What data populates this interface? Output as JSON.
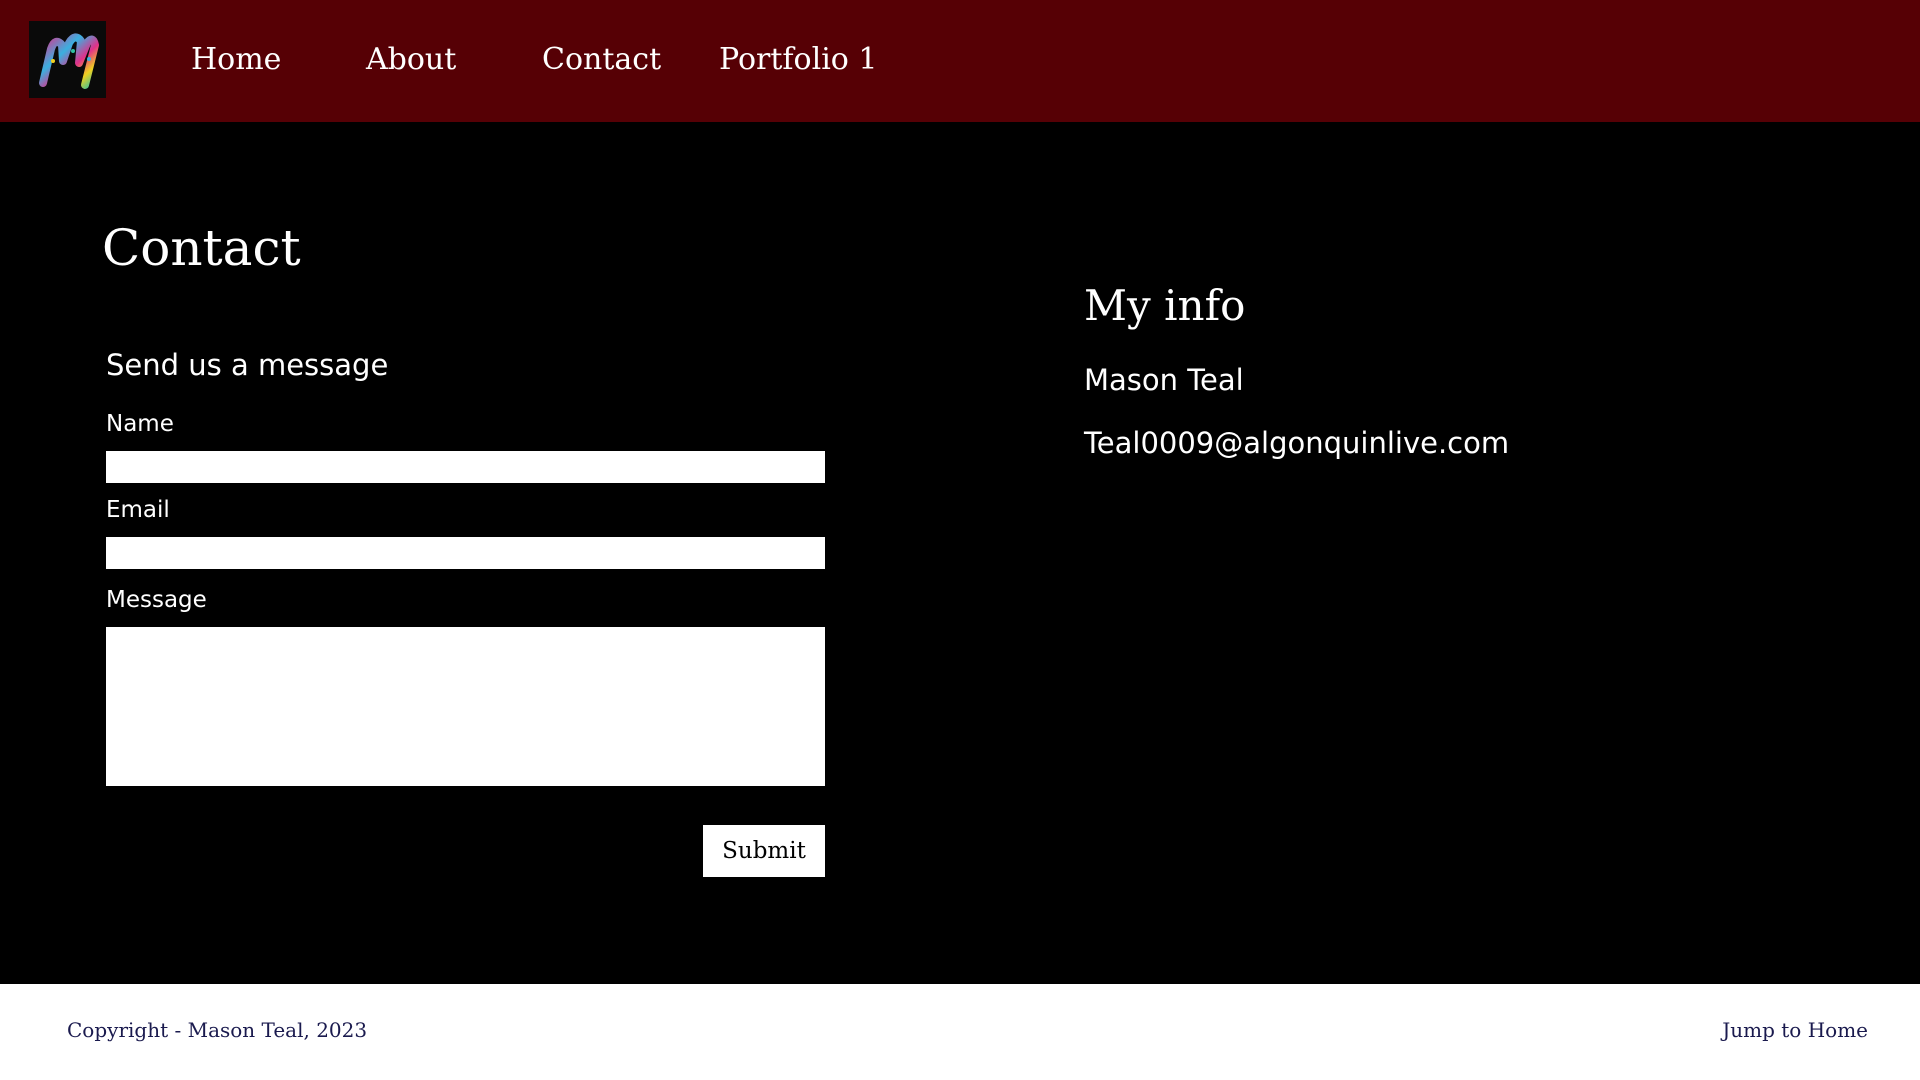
{
  "nav": {
    "logo_icon": "candy-cane-m-logo-icon",
    "links": [
      {
        "label": "Home"
      },
      {
        "label": "About"
      },
      {
        "label": "Contact"
      },
      {
        "label": "Portfolio 1"
      }
    ]
  },
  "main": {
    "title": "Contact",
    "form": {
      "heading": "Send us a message",
      "name_label": "Name",
      "name_value": "",
      "email_label": "Email",
      "email_value": "",
      "message_label": "Message",
      "message_value": "",
      "submit_label": "Submit"
    },
    "info": {
      "heading": "My info",
      "name": "Mason Teal",
      "email": "Teal0009@algonquinlive.com"
    }
  },
  "footer": {
    "copyright": "Copyright - Mason Teal, 2023",
    "jump_label": "Jump to Home"
  },
  "colors": {
    "nav_bg": "#560005",
    "main_bg": "#000000",
    "footer_bg": "#ffffff",
    "footer_text": "#1a1a4e"
  }
}
